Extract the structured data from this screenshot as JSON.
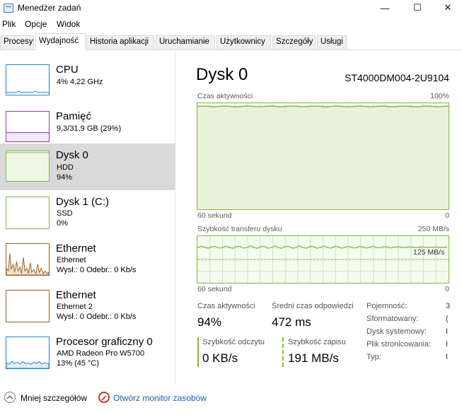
{
  "window": {
    "title": "Menedżer zadań",
    "minimize": "—",
    "maximize": "☐",
    "close": "✕"
  },
  "menu": [
    "Plik",
    "Opcje",
    "Widok"
  ],
  "tabs": [
    "Procesy",
    "Wydajność",
    "Historia aplikacji",
    "Uruchamianie",
    "Użytkownicy",
    "Szczegóły",
    "Usługi"
  ],
  "sidebar": [
    {
      "name": "CPU",
      "sub1": "4% 4,22 GHz",
      "sub2": "",
      "sub3": ""
    },
    {
      "name": "Pamięć",
      "sub1": "9,3/31,9 GB (29%)",
      "sub2": "",
      "sub3": ""
    },
    {
      "name": "Dysk 0",
      "sub1": "HDD",
      "sub2": "94%",
      "sub3": ""
    },
    {
      "name": "Dysk 1 (C:)",
      "sub1": "SSD",
      "sub2": "0%",
      "sub3": ""
    },
    {
      "name": "Ethernet",
      "sub1": "Ethernet",
      "sub2": "Wysł.: 0 Odebr.: 0 Kb/s",
      "sub3": ""
    },
    {
      "name": "Ethernet",
      "sub1": "Ethernet 2",
      "sub2": "Wysł.: 0 Odebr.: 0 Kb/s",
      "sub3": ""
    },
    {
      "name": "Procesor graficzny 0",
      "sub1": "AMD Radeon Pro W5700",
      "sub2": "13% (45 °C)",
      "sub3": ""
    }
  ],
  "main": {
    "title": "Dysk 0",
    "model": "ST4000DM004-2U9104",
    "graph1": {
      "label": "Czas aktywności",
      "max": "100%",
      "time": "60 sekund",
      "min": "0",
      "level": 0.97
    },
    "graph2": {
      "label": "Szybkość transferu dysku",
      "max": "250 MB/s",
      "mid": "125 MB/s",
      "time": "60 sekund",
      "min": "0",
      "level_mbs": 191
    },
    "stats": {
      "active_label": "Czas aktywności",
      "active_value": "94%",
      "resp_label": "Średni czas odpowiedzi",
      "resp_value": "472 ms",
      "read_label": "Szybkość odczytu",
      "read_value": "0 KB/s",
      "write_label": "Szybkość zapisu",
      "write_value": "191 MB/s"
    },
    "props": [
      {
        "key": "Pojemność:",
        "val": "3"
      },
      {
        "key": "Sformatowany:",
        "val": "("
      },
      {
        "key": "Dysk systemowy:",
        "val": "I"
      },
      {
        "key": "Plik stronicowania:",
        "val": "I"
      },
      {
        "key": "Typ:",
        "val": "I"
      }
    ]
  },
  "footer": {
    "less": "Mniej szczegółów",
    "monitor": "Otwórz monitor zasobów"
  },
  "colors": {
    "disk_green": "#7fb93f",
    "cpu_blue": "#1e84c9",
    "mem_purple": "#8b3f9c",
    "net_brown": "#a0612a"
  }
}
